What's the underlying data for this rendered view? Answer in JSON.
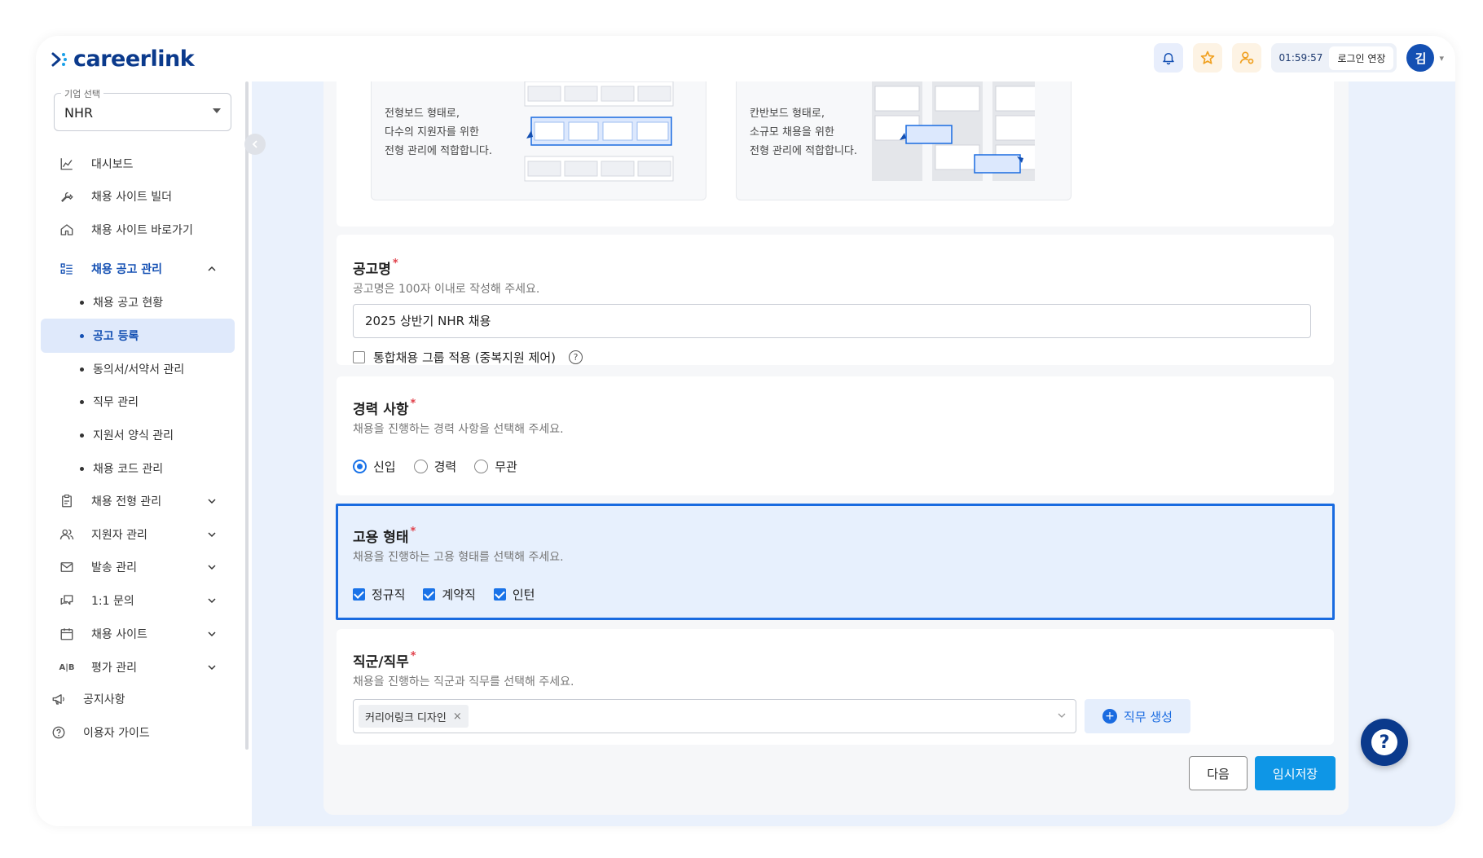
{
  "header": {
    "logo_text": "careerlink",
    "session_timer": "01:59:57",
    "extend_label": "로그인 연장",
    "avatar_initial": "김"
  },
  "sidebar": {
    "company_legend": "기업 선택",
    "company_value": "NHR",
    "menu": [
      {
        "label": "대시보드",
        "icon": "chart-icon"
      },
      {
        "label": "채용 사이트 빌더",
        "icon": "wrench-icon"
      },
      {
        "label": "채용 사이트 바로가기",
        "icon": "home-icon"
      },
      {
        "label": "채용 공고 관리",
        "icon": "list-icon"
      }
    ],
    "submenu": [
      {
        "label": "채용 공고 현황"
      },
      {
        "label": "공고 등록"
      },
      {
        "label": "동의서/서약서 관리"
      },
      {
        "label": "직무 관리"
      },
      {
        "label": "지원서 양식 관리"
      },
      {
        "label": "채용 코드 관리"
      }
    ],
    "menu2": [
      {
        "label": "채용 전형 관리",
        "icon": "clipboard-icon"
      },
      {
        "label": "지원자 관리",
        "icon": "people-icon"
      },
      {
        "label": "발송 관리",
        "icon": "mail-icon"
      },
      {
        "label": "1:1 문의",
        "icon": "chat-icon"
      },
      {
        "label": "채용 사이트",
        "icon": "calendar-icon"
      },
      {
        "label": "평가 관리",
        "icon": "ab-icon"
      }
    ],
    "bottom": [
      {
        "label": "공지사항",
        "icon": "megaphone-icon"
      },
      {
        "label": "이용자 가이드",
        "icon": "question-icon"
      }
    ]
  },
  "board": {
    "left_desc": [
      "전형보드 형태로,",
      "다수의 지원자를 위한",
      "전형 관리에 적합합니다."
    ],
    "right_desc": [
      "칸반보드 형태로,",
      "소규모 채용을 위한",
      "전형 관리에 적합합니다."
    ]
  },
  "title_field": {
    "label": "공고명",
    "required": "*",
    "help": "공고명은 100자 이내로 작성해 주세요.",
    "value": "2025 상반기 NHR 채용",
    "group_label": "통합채용 그룹 적용 (중복지원 제어)",
    "help_symbol": "?"
  },
  "career_field": {
    "label": "경력 사항",
    "required": "*",
    "help": "채용을 진행하는 경력 사항을 선택해 주세요.",
    "options": [
      {
        "label": "신입",
        "selected": true
      },
      {
        "label": "경력",
        "selected": false
      },
      {
        "label": "무관",
        "selected": false
      }
    ]
  },
  "employment_field": {
    "label": "고용 형태",
    "required": "*",
    "help": "채용을 진행하는 고용 형태를 선택해 주세요.",
    "options": [
      {
        "label": "정규직",
        "checked": true
      },
      {
        "label": "계약직",
        "checked": true
      },
      {
        "label": "인턴",
        "checked": true
      }
    ]
  },
  "job_field": {
    "label": "직군/직무",
    "required": "*",
    "help": "채용을 진행하는 직군과 직무를 선택해 주세요.",
    "chip": "커리어링크 디자인",
    "chip_remove": "×",
    "create_label": "직무 생성",
    "create_plus": "+"
  },
  "actions": {
    "next_label": "다음",
    "save_label": "임시저장"
  },
  "fab": {
    "symbol": "?"
  },
  "colors": {
    "brand": "#0b3a8c",
    "accent": "#1a73e8",
    "save": "#0e96e6",
    "required": "#e0404a"
  }
}
